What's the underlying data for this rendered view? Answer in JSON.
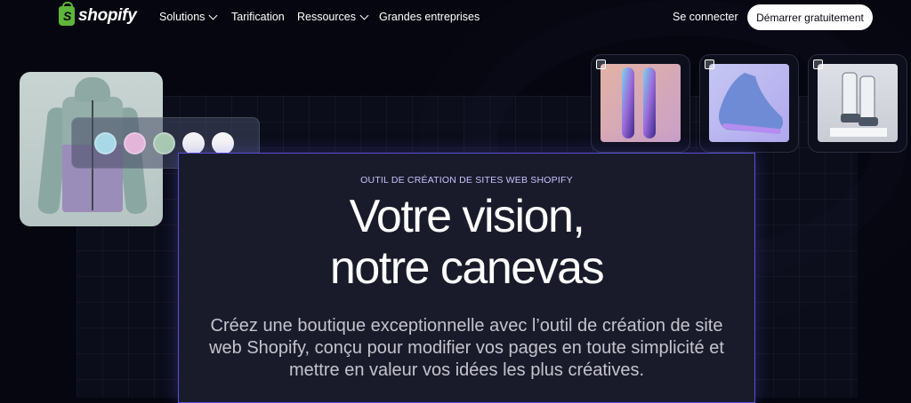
{
  "nav": {
    "brand": "shopify",
    "items": [
      {
        "label": "Solutions",
        "has_dropdown": true
      },
      {
        "label": "Tarification",
        "has_dropdown": false
      },
      {
        "label": "Ressources",
        "has_dropdown": true
      },
      {
        "label": "Grandes entreprises",
        "has_dropdown": false
      }
    ],
    "login_label": "Se connecter",
    "cta_label": "Démarrer gratuitement"
  },
  "hero": {
    "eyebrow": "OUTIL DE CRÉATION DE SITES WEB SHOPIFY",
    "title_line1": "Votre vision,",
    "title_line2": "notre canevas",
    "subtitle": "Créez une boutique exceptionnelle avec l’outil de création de site web Shopify, conçu pour modifier vos pages en toute simplicité et mettre en valeur vos idées les plus créatives."
  },
  "swatches": [
    "#a9d8e6",
    "#e3b5d9",
    "#a8c9b2",
    "#f2f2f5",
    "#f6f6f8"
  ],
  "colors": {
    "brand_green": "#5fb53a",
    "accent_border": "#5a4fd4",
    "background": "#05060f"
  },
  "product_cards": [
    {
      "name": "snowboard",
      "icon": "snowboard-image"
    },
    {
      "name": "sneaker",
      "icon": "sneaker-image"
    },
    {
      "name": "boots",
      "icon": "boots-image"
    }
  ]
}
